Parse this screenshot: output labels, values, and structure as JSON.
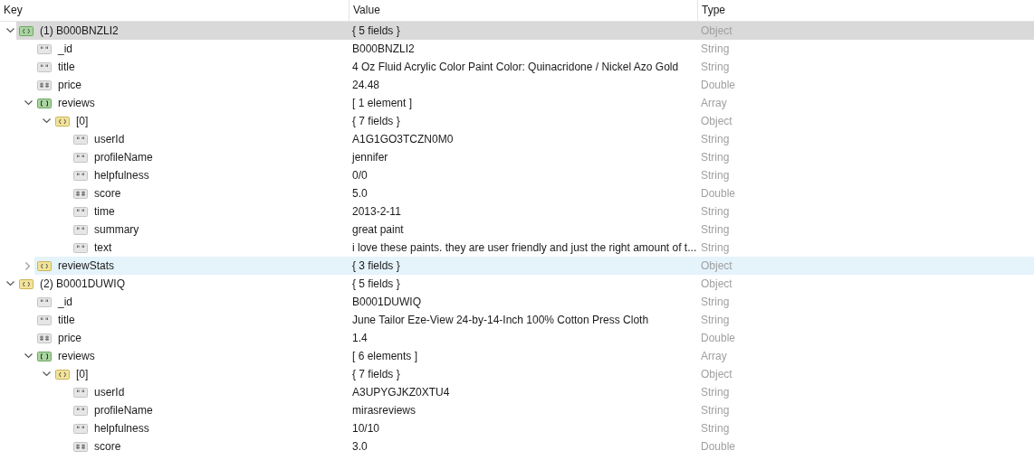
{
  "columns": [
    "Key",
    "Value",
    "Type"
  ],
  "rows": [
    {
      "key": "(1) B000BNZLI2",
      "value": "{ 5 fields }",
      "type": "Object",
      "kind": "object",
      "expanded": true,
      "selected": true,
      "hovered": false,
      "children": [
        {
          "key": "_id",
          "value": "B000BNZLI2",
          "type": "String",
          "kind": "string",
          "selected": false,
          "hovered": false
        },
        {
          "key": "title",
          "value": "4 Oz Fluid Acrylic Color Paint Color: Quinacridone / Nickel Azo Gold",
          "type": "String",
          "kind": "string",
          "selected": false,
          "hovered": false
        },
        {
          "key": "price",
          "value": "24.48",
          "type": "Double",
          "kind": "number",
          "selected": false,
          "hovered": false
        },
        {
          "key": "reviews",
          "value": "[ 1 element ]",
          "type": "Array",
          "kind": "array",
          "expanded": true,
          "selected": false,
          "hovered": false,
          "children": [
            {
              "key": "[0]",
              "value": "{ 7 fields }",
              "type": "Object",
              "kind": "object",
              "expanded": true,
              "selected": false,
              "hovered": false,
              "children": [
                {
                  "key": "userId",
                  "value": "A1G1GO3TCZN0M0",
                  "type": "String",
                  "kind": "string",
                  "selected": false,
                  "hovered": false
                },
                {
                  "key": "profileName",
                  "value": "jennifer",
                  "type": "String",
                  "kind": "string",
                  "selected": false,
                  "hovered": false
                },
                {
                  "key": "helpfulness",
                  "value": "0/0",
                  "type": "String",
                  "kind": "string",
                  "selected": false,
                  "hovered": false
                },
                {
                  "key": "score",
                  "value": "5.0",
                  "type": "Double",
                  "kind": "number",
                  "selected": false,
                  "hovered": false
                },
                {
                  "key": "time",
                  "value": "2013-2-11",
                  "type": "String",
                  "kind": "string",
                  "selected": false,
                  "hovered": false
                },
                {
                  "key": "summary",
                  "value": "great paint",
                  "type": "String",
                  "kind": "string",
                  "selected": false,
                  "hovered": false
                },
                {
                  "key": "text",
                  "value": "i love these paints. they are user friendly and just the right amount of t...",
                  "type": "String",
                  "kind": "string",
                  "selected": false,
                  "hovered": false
                }
              ]
            }
          ]
        },
        {
          "key": "reviewStats",
          "value": "{ 3 fields }",
          "type": "Object",
          "kind": "object",
          "expanded": false,
          "selected": false,
          "hovered": true
        }
      ]
    },
    {
      "key": "(2) B0001DUWIQ",
      "value": "{ 5 fields }",
      "type": "Object",
      "kind": "object",
      "expanded": true,
      "selected": false,
      "hovered": false,
      "children": [
        {
          "key": "_id",
          "value": "B0001DUWIQ",
          "type": "String",
          "kind": "string",
          "selected": false,
          "hovered": false
        },
        {
          "key": "title",
          "value": "June Tailor Eze-View 24-by-14-Inch 100% Cotton Press Cloth",
          "type": "String",
          "kind": "string",
          "selected": false,
          "hovered": false
        },
        {
          "key": "price",
          "value": "1.4",
          "type": "Double",
          "kind": "number",
          "selected": false,
          "hovered": false
        },
        {
          "key": "reviews",
          "value": "[ 6 elements ]",
          "type": "Array",
          "kind": "array",
          "expanded": true,
          "selected": false,
          "hovered": false,
          "children": [
            {
              "key": "[0]",
              "value": "{ 7 fields }",
              "type": "Object",
              "kind": "object",
              "expanded": true,
              "selected": false,
              "hovered": false,
              "children": [
                {
                  "key": "userId",
                  "value": "A3UPYGJKZ0XTU4",
                  "type": "String",
                  "kind": "string",
                  "selected": false,
                  "hovered": false
                },
                {
                  "key": "profileName",
                  "value": "mirasreviews",
                  "type": "String",
                  "kind": "string",
                  "selected": false,
                  "hovered": false
                },
                {
                  "key": "helpfulness",
                  "value": "10/10",
                  "type": "String",
                  "kind": "string",
                  "selected": false,
                  "hovered": false
                },
                {
                  "key": "score",
                  "value": "3.0",
                  "type": "Double",
                  "kind": "number",
                  "selected": false,
                  "hovered": false
                }
              ]
            }
          ]
        }
      ]
    }
  ]
}
